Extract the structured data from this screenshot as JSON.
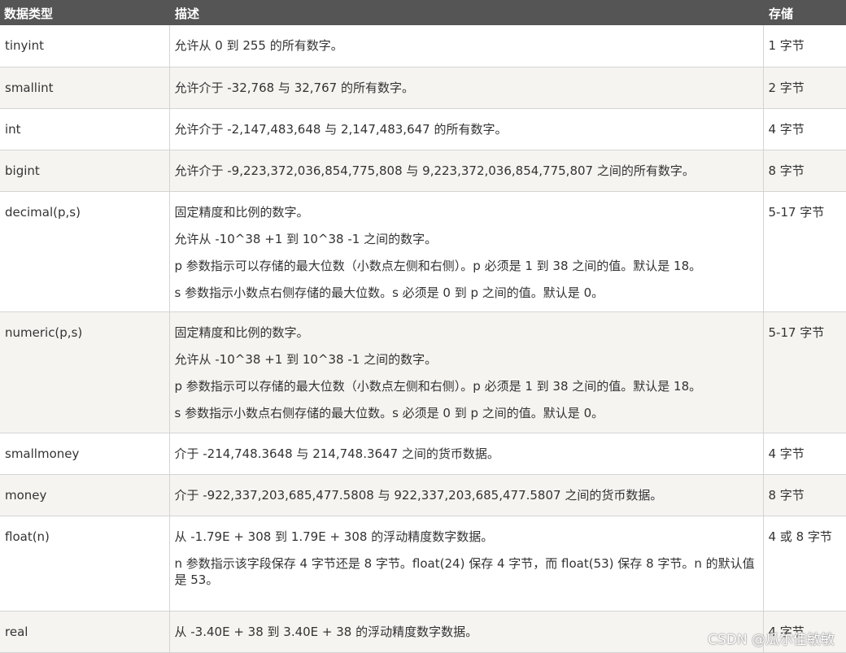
{
  "header": {
    "type": "数据类型",
    "desc": "描述",
    "storage": "存储"
  },
  "rows": [
    {
      "type": "tinyint",
      "desc": [
        "允许从 0 到 255 的所有数字。"
      ],
      "storage": "1 字节"
    },
    {
      "type": "smallint",
      "desc": [
        "允许介于 -32,768 与 32,767 的所有数字。"
      ],
      "storage": "2 字节"
    },
    {
      "type": "int",
      "desc": [
        "允许介于 -2,147,483,648 与 2,147,483,647 的所有数字。"
      ],
      "storage": "4 字节"
    },
    {
      "type": "bigint",
      "desc": [
        "允许介于 -9,223,372,036,854,775,808 与 9,223,372,036,854,775,807 之间的所有数字。"
      ],
      "storage": "8 字节"
    },
    {
      "type": "decimal(p,s)",
      "desc": [
        "固定精度和比例的数字。",
        "允许从 -10^38 +1 到 10^38 -1 之间的数字。",
        "p 参数指示可以存储的最大位数（小数点左侧和右侧）。p 必须是 1 到 38 之间的值。默认是 18。",
        "s 参数指示小数点右侧存储的最大位数。s 必须是 0 到 p 之间的值。默认是 0。"
      ],
      "storage": "5-17 字节"
    },
    {
      "type": "numeric(p,s)",
      "desc": [
        "固定精度和比例的数字。",
        "允许从 -10^38 +1 到 10^38 -1 之间的数字。",
        "p 参数指示可以存储的最大位数（小数点左侧和右侧）。p 必须是 1 到 38 之间的值。默认是 18。",
        "s 参数指示小数点右侧存储的最大位数。s 必须是 0 到 p 之间的值。默认是 0。"
      ],
      "storage": "5-17 字节"
    },
    {
      "type": "smallmoney",
      "desc": [
        "介于 -214,748.3648 与 214,748.3647 之间的货币数据。"
      ],
      "storage": "4 字节"
    },
    {
      "type": "money",
      "desc": [
        "介于 -922,337,203,685,477.5808 与 922,337,203,685,477.5807 之间的货币数据。"
      ],
      "storage": "8 字节"
    },
    {
      "type": "float(n)",
      "desc": [
        "从 -1.79E + 308 到 1.79E + 308 的浮动精度数字数据。",
        "n 参数指示该字段保存 4 字节还是 8 字节。float(24) 保存 4 字节，而 float(53) 保存 8 字节。n 的默认值是 53。"
      ],
      "storage": "4 或 8 字节"
    },
    {
      "type": "real",
      "desc": [
        "从 -3.40E + 38 到 3.40E + 38 的浮动精度数字数据。"
      ],
      "storage": "4 字节"
    }
  ],
  "watermark": "CSDN @瓜尔佳敏敏"
}
